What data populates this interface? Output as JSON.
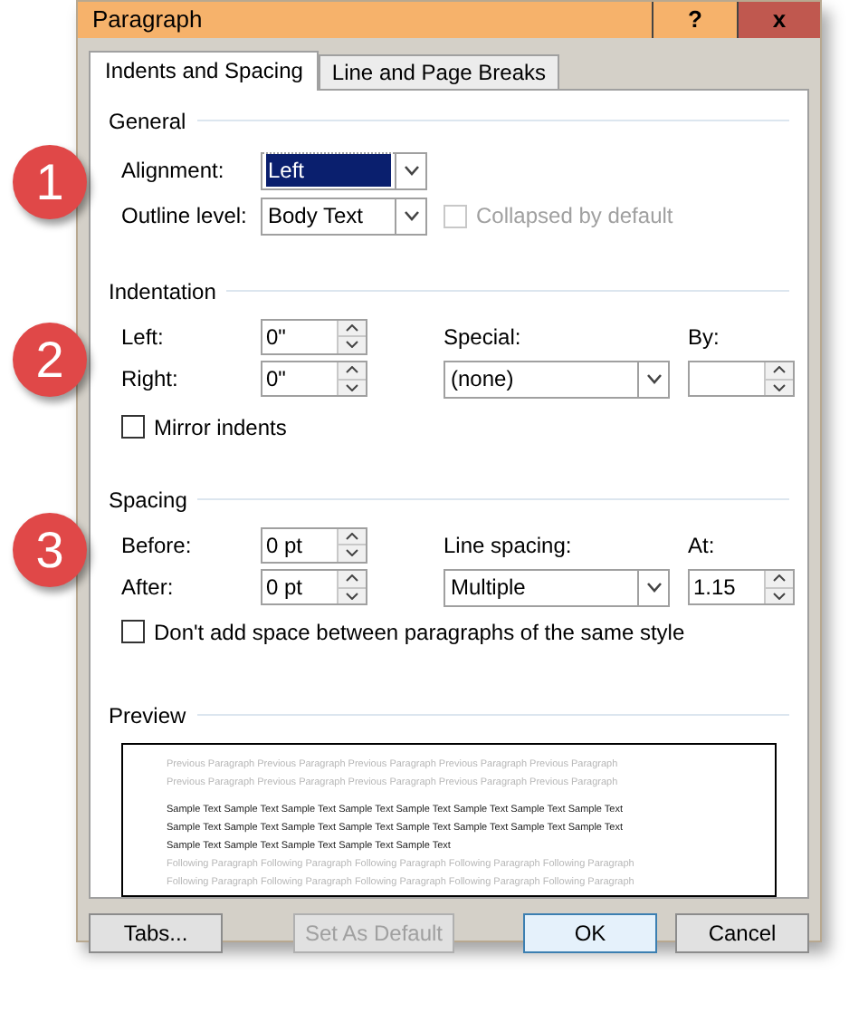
{
  "window": {
    "title": "Paragraph",
    "help_label": "?",
    "close_label": "x"
  },
  "tabs": [
    {
      "label": "Indents and Spacing",
      "selected": true
    },
    {
      "label": "Line and Page Breaks",
      "selected": false
    }
  ],
  "general": {
    "heading": "General",
    "alignment": {
      "label": "Alignment:",
      "value": "Left",
      "focused": true
    },
    "outline_level": {
      "label": "Outline level:",
      "value": "Body Text"
    },
    "collapsed": {
      "label": "Collapsed by default",
      "checked": false,
      "disabled": true
    }
  },
  "indentation": {
    "heading": "Indentation",
    "left": {
      "label": "Left:",
      "value": "0\""
    },
    "right": {
      "label": "Right:",
      "value": "0\""
    },
    "special": {
      "label": "Special:",
      "value": "(none)"
    },
    "by": {
      "label": "By:"
    },
    "mirror": {
      "label": "Mirror indents",
      "checked": false
    }
  },
  "spacing": {
    "heading": "Spacing",
    "before": {
      "label": "Before:",
      "value": "0 pt"
    },
    "after": {
      "label": "After:",
      "value": "0 pt"
    },
    "line_spacing": {
      "label": "Line spacing:",
      "value": "Multiple"
    },
    "at": {
      "label": "At:",
      "value": "1.15"
    },
    "dont_add": {
      "label": "Don't add space between paragraphs of the same style",
      "checked": false
    }
  },
  "preview": {
    "heading": "Preview",
    "lines": [
      {
        "kind": "previous",
        "text": "Previous Paragraph Previous Paragraph Previous Paragraph Previous Paragraph Previous Paragraph"
      },
      {
        "kind": "previous",
        "text": "Previous Paragraph Previous Paragraph Previous Paragraph Previous Paragraph Previous Paragraph"
      },
      {
        "kind": "sample",
        "text": "Sample Text Sample Text Sample Text Sample Text Sample Text Sample Text Sample Text Sample Text"
      },
      {
        "kind": "sample",
        "text": "Sample Text Sample Text Sample Text Sample Text Sample Text Sample Text Sample Text Sample Text"
      },
      {
        "kind": "sample",
        "text": "Sample Text Sample Text Sample Text Sample Text Sample Text"
      },
      {
        "kind": "following",
        "text": "Following Paragraph Following Paragraph Following Paragraph Following Paragraph Following Paragraph"
      },
      {
        "kind": "following",
        "text": "Following Paragraph Following Paragraph Following Paragraph Following Paragraph Following Paragraph"
      }
    ]
  },
  "buttons": [
    {
      "label": "Tabs...",
      "disabled": false,
      "default": false
    },
    {
      "label": "Set As Default",
      "disabled": true,
      "default": false
    },
    {
      "label": "OK",
      "disabled": false,
      "default": true
    },
    {
      "label": "Cancel",
      "disabled": false,
      "default": false
    }
  ],
  "callouts": [
    "1",
    "2",
    "3"
  ]
}
